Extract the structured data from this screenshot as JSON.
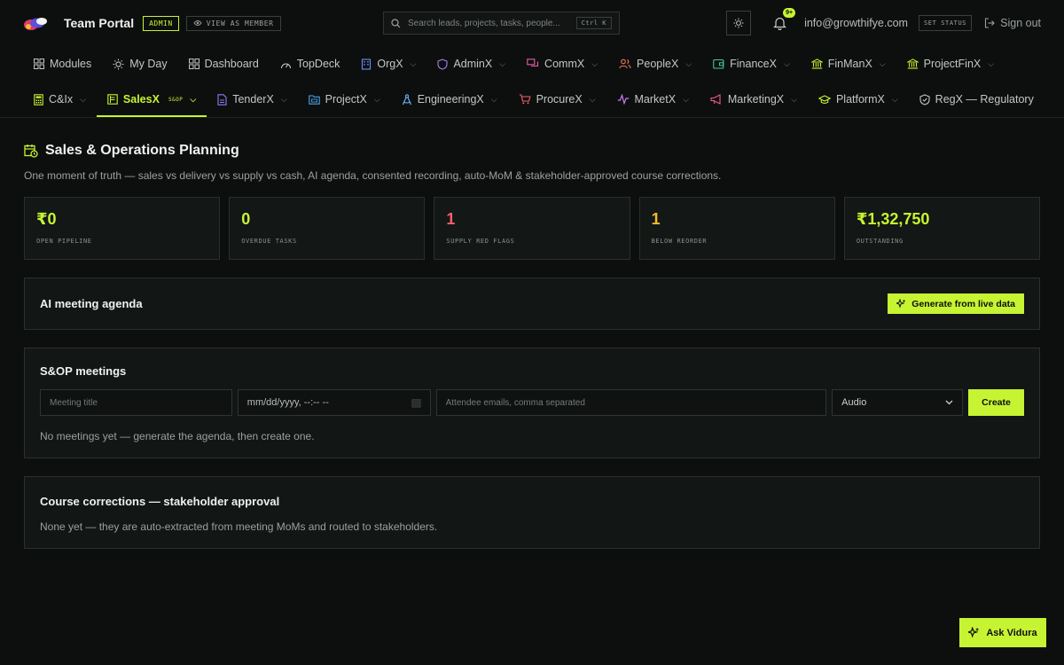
{
  "brand": {
    "title": "Team Portal",
    "role_badge": "ADMIN",
    "view_as": "VIEW AS MEMBER"
  },
  "search": {
    "placeholder": "Search leads, projects, tasks, people...",
    "shortcut": "Ctrl K"
  },
  "header": {
    "notifications": "9+",
    "email": "info@growthifye.com",
    "set_status": "SET STATUS",
    "sign_out": "Sign out"
  },
  "nav_row1": [
    {
      "label": "Modules",
      "icon": "grid-icon",
      "dropdown": false
    },
    {
      "label": "My Day",
      "icon": "sun-icon",
      "dropdown": false
    },
    {
      "label": "Dashboard",
      "icon": "grid-icon",
      "dropdown": false
    },
    {
      "label": "TopDeck",
      "icon": "gauge-icon",
      "dropdown": false
    },
    {
      "label": "OrgX",
      "icon": "building-icon",
      "dropdown": true
    },
    {
      "label": "AdminX",
      "icon": "shield-icon",
      "dropdown": true
    },
    {
      "label": "CommX",
      "icon": "chat-icon",
      "dropdown": true
    },
    {
      "label": "PeopleX",
      "icon": "people-icon",
      "dropdown": true
    },
    {
      "label": "FinanceX",
      "icon": "wallet-icon",
      "dropdown": true
    },
    {
      "label": "FinManX",
      "icon": "bank-icon",
      "dropdown": true
    },
    {
      "label": "ProjectFinX",
      "icon": "bank-icon",
      "dropdown": true
    }
  ],
  "nav_row2": [
    {
      "label": "C&Ix",
      "icon": "calculator-icon",
      "dropdown": true
    },
    {
      "label": "SalesX",
      "tag": "S&OP",
      "icon": "ledger-icon",
      "dropdown": true,
      "active": true
    },
    {
      "label": "TenderX",
      "icon": "file-icon",
      "dropdown": true
    },
    {
      "label": "ProjectX",
      "icon": "folder-icon",
      "dropdown": true
    },
    {
      "label": "EngineeringX",
      "icon": "compass-icon",
      "dropdown": true
    },
    {
      "label": "ProcureX",
      "icon": "cart-icon",
      "dropdown": true
    },
    {
      "label": "MarketX",
      "icon": "pulse-icon",
      "dropdown": true
    },
    {
      "label": "MarketingX",
      "icon": "megaphone-icon",
      "dropdown": true
    },
    {
      "label": "PlatformX",
      "icon": "graduation-icon",
      "dropdown": true
    },
    {
      "label": "RegX — Regulatory",
      "icon": "shield-check-icon",
      "dropdown": false
    }
  ],
  "page": {
    "title": "Sales & Operations Planning",
    "subtitle": "One moment of truth — sales vs delivery vs supply vs cash, AI agenda, consented recording, auto-MoM & stakeholder-approved course corrections."
  },
  "kpis": [
    {
      "value": "₹0",
      "label": "OPEN PIPELINE",
      "color": "#c6f432"
    },
    {
      "value": "0",
      "label": "OVERDUE TASKS",
      "color": "#c6f432"
    },
    {
      "value": "1",
      "label": "SUPPLY RED FLAGS",
      "color": "#f2606b"
    },
    {
      "value": "1",
      "label": "BELOW REORDER",
      "color": "#f5b82e"
    },
    {
      "value": "₹1,32,750",
      "label": "OUTSTANDING",
      "color": "#c6f432"
    }
  ],
  "agenda": {
    "title": "AI meeting agenda",
    "button": "Generate from live data"
  },
  "meetings": {
    "title": "S&OP meetings",
    "title_placeholder": "Meeting title",
    "date_placeholder": "mm/dd/yyyy, --:-- --",
    "emails_placeholder": "Attendee emails, comma separated",
    "mode": "Audio",
    "create": "Create",
    "empty": "No meetings yet — generate the agenda, then create one."
  },
  "corrections": {
    "title": "Course corrections — stakeholder approval",
    "empty": "None yet — they are auto-extracted from meeting MoMs and routed to stakeholders."
  },
  "assistant": {
    "label": "Ask Vidura"
  }
}
